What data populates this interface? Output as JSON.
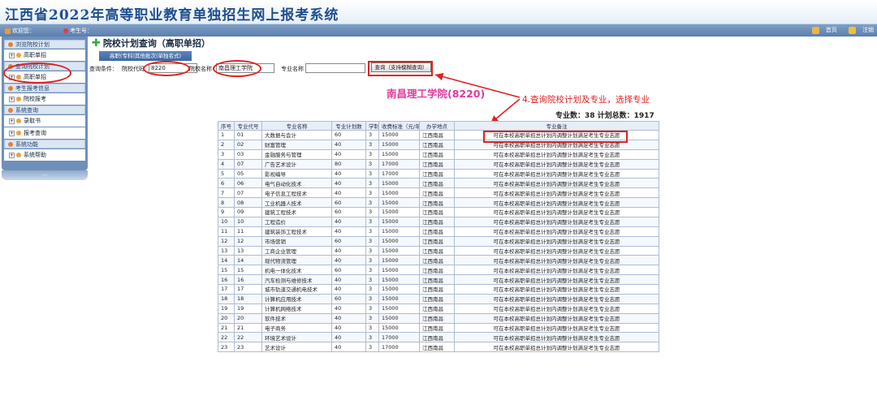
{
  "header": {
    "title": "江西省2022年高等职业教育单独招生网上报考系统"
  },
  "infobar": {
    "welcome_label": "欢迎您：",
    "examinee_label": "考生号：",
    "home_label": "首页",
    "logout_label": "注销"
  },
  "sidebar": {
    "groups": [
      {
        "label": "浏览院校计划",
        "items": [
          {
            "label": "高职单招"
          }
        ]
      },
      {
        "label": "查询院校计划",
        "items": [
          {
            "label": "高职单招"
          }
        ]
      },
      {
        "label": "考生报考信息",
        "items": [
          {
            "label": "院校报考"
          }
        ]
      },
      {
        "label": "系统查询",
        "items": [
          {
            "label": "录取书"
          },
          {
            "label": "报考查询"
          }
        ]
      },
      {
        "label": "系统功能",
        "items": [
          {
            "label": "系统帮助"
          }
        ]
      }
    ],
    "bottom_label": "..."
  },
  "main": {
    "page_title": "院校计划查询（高职单招）",
    "sub_tab": "高职(专科)其他批次(单独名式)",
    "search": {
      "condition_label": "查询条件：",
      "code_label": "院校代码",
      "code_value": "8220",
      "name_label": "院校名称",
      "name_value": "南昌理工学院",
      "major_label": "专业名称",
      "major_value": "",
      "button_label": "查询（支持模糊查询）"
    },
    "school_label": "南昌理工学院(8220)",
    "annotation": "4.查询院校计划及专业，选择专业",
    "totals": "专业数：38    计划总数：1917"
  },
  "table": {
    "headers": [
      "序号",
      "专业代号",
      "专业名称",
      "专业计划数",
      "学制",
      "收费标准（元/年）",
      "办学地点",
      "专业备注"
    ],
    "rows": [
      [
        "1",
        "01",
        "大数据与会计",
        "60",
        "3",
        "15000",
        "江西南昌",
        "可在本校高职单招总计划内调整计划满足考生专业志愿"
      ],
      [
        "2",
        "02",
        "财富管理",
        "40",
        "3",
        "15000",
        "江西南昌",
        "可在本校高职单招总计划内调整计划满足考生专业志愿"
      ],
      [
        "3",
        "03",
        "金融服务与管理",
        "40",
        "3",
        "15000",
        "江西南昌",
        "可在本校高职单招总计划内调整计划满足考生专业志愿"
      ],
      [
        "4",
        "07",
        "广告艺术设计",
        "80",
        "3",
        "17000",
        "江西南昌",
        "可在本校高职单招总计划内调整计划满足考生专业志愿"
      ],
      [
        "5",
        "05",
        "影视编导",
        "40",
        "3",
        "17000",
        "江西南昌",
        "可在本校高职单招总计划内调整计划满足考生专业志愿"
      ],
      [
        "6",
        "06",
        "电气自动化技术",
        "40",
        "3",
        "15000",
        "江西南昌",
        "可在本校高职单招总计划内调整计划满足考生专业志愿"
      ],
      [
        "7",
        "07",
        "电子信息工程技术",
        "40",
        "3",
        "15000",
        "江西南昌",
        "可在本校高职单招总计划内调整计划满足考生专业志愿"
      ],
      [
        "8",
        "08",
        "工业机器人技术",
        "60",
        "3",
        "15000",
        "江西南昌",
        "可在本校高职单招总计划内调整计划满足考生专业志愿"
      ],
      [
        "9",
        "09",
        "建筑工程技术",
        "60",
        "3",
        "15000",
        "江西南昌",
        "可在本校高职单招总计划内调整计划满足考生专业志愿"
      ],
      [
        "10",
        "10",
        "工程造价",
        "40",
        "3",
        "15000",
        "江西南昌",
        "可在本校高职单招总计划内调整计划满足考生专业志愿"
      ],
      [
        "11",
        "11",
        "建筑装饰工程技术",
        "40",
        "3",
        "15000",
        "江西南昌",
        "可在本校高职单招总计划内调整计划满足考生专业志愿"
      ],
      [
        "12",
        "12",
        "市场营销",
        "60",
        "3",
        "15000",
        "江西南昌",
        "可在本校高职单招总计划内调整计划满足考生专业志愿"
      ],
      [
        "13",
        "13",
        "工商企业管理",
        "40",
        "3",
        "15000",
        "江西南昌",
        "可在本校高职单招总计划内调整计划满足考生专业志愿"
      ],
      [
        "14",
        "14",
        "现代物流管理",
        "40",
        "3",
        "15000",
        "江西南昌",
        "可在本校高职单招总计划内调整计划满足考生专业志愿"
      ],
      [
        "15",
        "15",
        "机电一体化技术",
        "60",
        "3",
        "15000",
        "江西南昌",
        "可在本校高职单招总计划内调整计划满足考生专业志愿"
      ],
      [
        "16",
        "16",
        "汽车检测与维修技术",
        "40",
        "3",
        "15000",
        "江西南昌",
        "可在本校高职单招总计划内调整计划满足考生专业志愿"
      ],
      [
        "17",
        "17",
        "城市轨道交通机电技术",
        "40",
        "3",
        "15000",
        "江西南昌",
        "可在本校高职单招总计划内调整计划满足考生专业志愿"
      ],
      [
        "18",
        "18",
        "计算机应用技术",
        "60",
        "3",
        "15000",
        "江西南昌",
        "可在本校高职单招总计划内调整计划满足考生专业志愿"
      ],
      [
        "19",
        "19",
        "计算机网络技术",
        "40",
        "3",
        "15000",
        "江西南昌",
        "可在本校高职单招总计划内调整计划满足考生专业志愿"
      ],
      [
        "20",
        "20",
        "软件技术",
        "40",
        "3",
        "15000",
        "江西南昌",
        "可在本校高职单招总计划内调整计划满足考生专业志愿"
      ],
      [
        "21",
        "21",
        "电子商务",
        "40",
        "3",
        "15000",
        "江西南昌",
        "可在本校高职单招总计划内调整计划满足考生专业志愿"
      ],
      [
        "22",
        "22",
        "环境艺术设计",
        "40",
        "3",
        "17000",
        "江西南昌",
        "可在本校高职单招总计划内调整计划满足考生专业志愿"
      ],
      [
        "23",
        "23",
        "艺术设计",
        "40",
        "3",
        "17000",
        "江西南昌",
        "可在本校高职单招总计划内调整计划满足考生专业志愿"
      ]
    ]
  },
  "colors": {
    "highlight": "#e02020",
    "school_label": "#e03aa0",
    "header_text": "#1f4f8f"
  }
}
